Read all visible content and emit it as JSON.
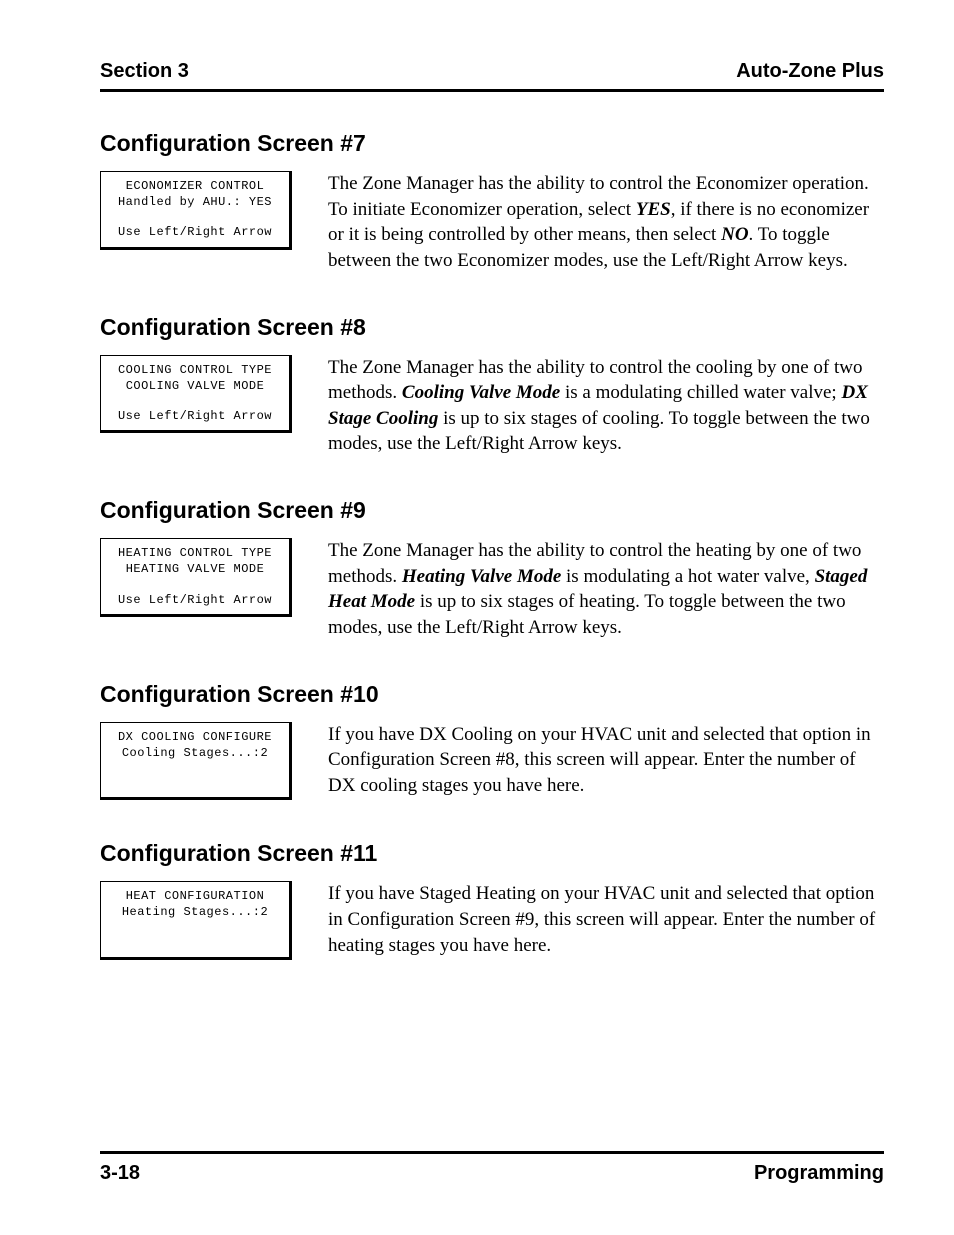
{
  "header": {
    "left": "Section 3",
    "right": "Auto-Zone Plus"
  },
  "sections": [
    {
      "heading": "Configuration Screen #7",
      "screen": {
        "line1": "ECONOMIZER CONTROL",
        "line2": "Handled by AHU.: YES",
        "line3": "Use Left/Right Arrow"
      },
      "desc_parts": [
        {
          "t": "The Zone Manager has the ability to control the Economizer operation. To initiate Economizer operation, select ",
          "b": false,
          "i": false
        },
        {
          "t": "YES",
          "b": true,
          "i": true
        },
        {
          "t": ", if there is no economizer or it is being controlled by other means, then select ",
          "b": false,
          "i": false
        },
        {
          "t": "NO",
          "b": true,
          "i": true
        },
        {
          "t": ". To toggle between the two Economizer modes, use the Left/Right Arrow keys.",
          "b": false,
          "i": false
        }
      ]
    },
    {
      "heading": "Configuration Screen #8",
      "screen": {
        "line1": "COOLING CONTROL TYPE",
        "line2": "COOLING VALVE MODE",
        "line3": "Use Left/Right Arrow"
      },
      "desc_parts": [
        {
          "t": "The Zone Manager has the ability to control the cooling by one of two methods. ",
          "b": false,
          "i": false
        },
        {
          "t": "Cooling Valve Mode",
          "b": true,
          "i": true
        },
        {
          "t": " is a modulating chilled water valve; ",
          "b": false,
          "i": false
        },
        {
          "t": "DX Stage Cooling",
          "b": true,
          "i": true
        },
        {
          "t": " is up to six stages of cooling. To toggle between the two modes, use the Left/Right Arrow keys.",
          "b": false,
          "i": false
        }
      ]
    },
    {
      "heading": "Configuration Screen #9",
      "screen": {
        "line1": "HEATING CONTROL TYPE",
        "line2": "HEATING VALVE MODE",
        "line3": "Use Left/Right Arrow"
      },
      "desc_parts": [
        {
          "t": "The Zone Manager has the ability to control the heating by one of two methods. ",
          "b": false,
          "i": false
        },
        {
          "t": "Heating Valve Mode",
          "b": true,
          "i": true
        },
        {
          "t": " is modulating a hot water valve, ",
          "b": false,
          "i": false
        },
        {
          "t": "Staged Heat Mode",
          "b": true,
          "i": true
        },
        {
          "t": " is up to six stages of heating. To toggle between the two modes, use the Left/Right Arrow keys.",
          "b": false,
          "i": false
        }
      ]
    },
    {
      "heading": "Configuration Screen #10",
      "screen": {
        "line1": "DX COOLING CONFIGURE",
        "line2": "Cooling Stages...:2",
        "line3": ""
      },
      "desc_parts": [
        {
          "t": "If you have DX Cooling on your HVAC unit and selected that option in Configuration Screen #8, this screen will appear. Enter the number of DX cooling stages you have here.",
          "b": false,
          "i": false
        }
      ]
    },
    {
      "heading": "Configuration Screen #11",
      "screen": {
        "line1": "HEAT CONFIGURATION",
        "line2": "Heating Stages...:2",
        "line3": ""
      },
      "desc_parts": [
        {
          "t": "If you have  Staged Heating on your HVAC unit and selected that option in Configuration Screen #9, this screen will appear. Enter the number of heating stages you have here.",
          "b": false,
          "i": false
        }
      ]
    }
  ],
  "footer": {
    "left": "3-18",
    "right": "Programming"
  }
}
